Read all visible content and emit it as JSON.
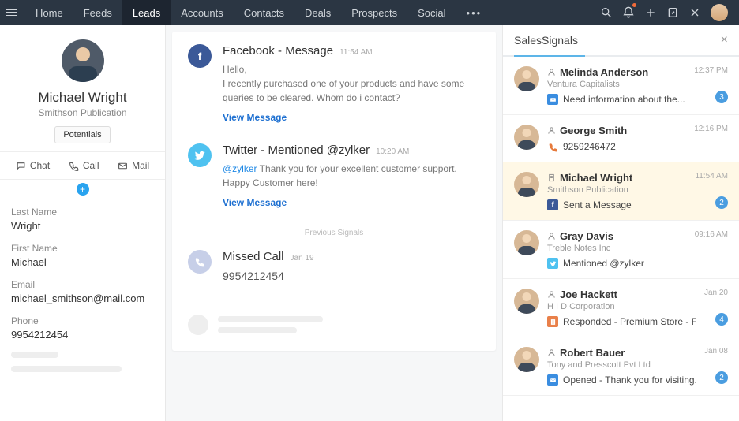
{
  "nav": {
    "items": [
      "Home",
      "Feeds",
      "Leads",
      "Accounts",
      "Contacts",
      "Deals",
      "Prospects",
      "Social"
    ],
    "active_index": 2
  },
  "lead": {
    "name": "Michael Wright",
    "company": "Smithson Publication",
    "tag": "Potentials",
    "actions": {
      "chat": "Chat",
      "call": "Call",
      "mail": "Mail"
    },
    "fields": {
      "last_name": {
        "label": "Last Name",
        "value": "Wright"
      },
      "first_name": {
        "label": "First Name",
        "value": "Michael"
      },
      "email": {
        "label": "Email",
        "value": "michael_smithson@mail.com"
      },
      "phone": {
        "label": "Phone",
        "value": "9954212454"
      }
    }
  },
  "feed": {
    "items": [
      {
        "icon": "fb",
        "title": "Facebook - Message",
        "time": "11:54 AM",
        "body_plain": "Hello,\nI recently purchased one of your products and have some queries to be cleared. Whom do i contact?",
        "link": "View Message"
      },
      {
        "icon": "tw",
        "title": "Twitter - Mentioned @zylker",
        "time": "10:20 AM",
        "mention": "@zylker",
        "body_after": " Thank you for your excellent customer support. Happy Customer here!",
        "link": "View Message"
      }
    ],
    "divider": "Previous Signals",
    "missed": {
      "title": "Missed Call",
      "time": "Jan 19",
      "number": "9954212454"
    }
  },
  "salessignals": {
    "title": "SalesSignals",
    "items": [
      {
        "name": "Melinda Anderson",
        "sub": "Ventura Capitalists",
        "icon": "mail",
        "msg": "Need information about the...",
        "time": "12:37 PM",
        "badge": "3"
      },
      {
        "name": "George Smith",
        "sub": "",
        "icon": "phone",
        "msg": "9259246472",
        "time": "12:16 PM",
        "badge": ""
      },
      {
        "name": "Michael Wright",
        "sub": "Smithson Publication",
        "icon": "fb",
        "msg": "Sent a Message",
        "time": "11:54 AM",
        "badge": "2",
        "active": true,
        "name_icon": "page"
      },
      {
        "name": "Gray Davis",
        "sub": "Treble Notes Inc",
        "icon": "tw",
        "msg": "Mentioned @zylker",
        "time": "09:16 AM",
        "badge": ""
      },
      {
        "name": "Joe Hackett",
        "sub": "H I D Corporation",
        "icon": "file",
        "msg": "Responded - Premium Store - Fee...",
        "time": "Jan 20",
        "badge": "4"
      },
      {
        "name": "Robert Bauer",
        "sub": "Tony and Presscott Pvt Ltd",
        "icon": "mail",
        "msg": "Opened - Thank you for visiting...",
        "time": "Jan 08",
        "badge": "2"
      }
    ]
  }
}
